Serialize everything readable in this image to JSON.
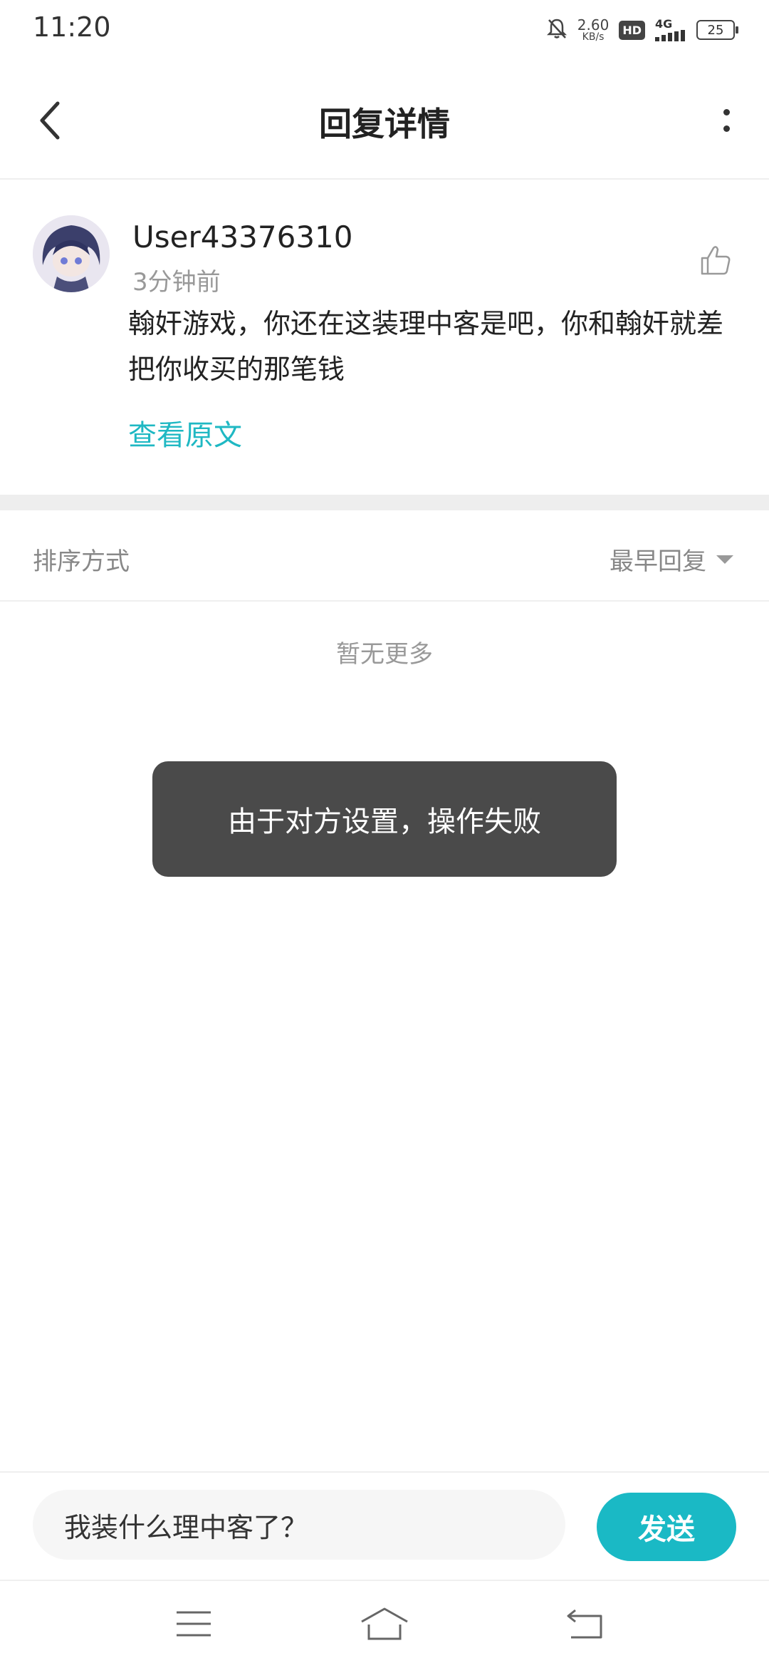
{
  "status_bar": {
    "time": "11:20",
    "net_speed_value": "2.60",
    "net_speed_unit": "KB/s",
    "hd_label": "HD",
    "network_label": "4G",
    "battery_level": "25"
  },
  "header": {
    "title": "回复详情"
  },
  "comment": {
    "username": "User43376310",
    "timestamp": "3分钟前",
    "text": "翰奸游戏，你还在这装理中客是吧，你和翰奸就差把你收买的那笔钱",
    "view_original_label": "查看原文"
  },
  "sort": {
    "label": "排序方式",
    "selected": "最早回复"
  },
  "list": {
    "empty_text": "暂无更多"
  },
  "toast": {
    "message": "由于对方设置，操作失败"
  },
  "reply_bar": {
    "input_value": "我装什么理中客了？",
    "send_label": "发送"
  },
  "colors": {
    "accent": "#1ab9c5",
    "link": "#1fb8c3",
    "toast_bg": "#4a4a4a"
  },
  "icons": {
    "back": "chevron-left-icon",
    "more": "more-vertical-icon",
    "like": "thumbs-up-icon",
    "sort_caret": "caret-down-icon",
    "nav_menu": "menu-icon",
    "nav_home": "home-icon",
    "nav_back": "back-icon"
  }
}
